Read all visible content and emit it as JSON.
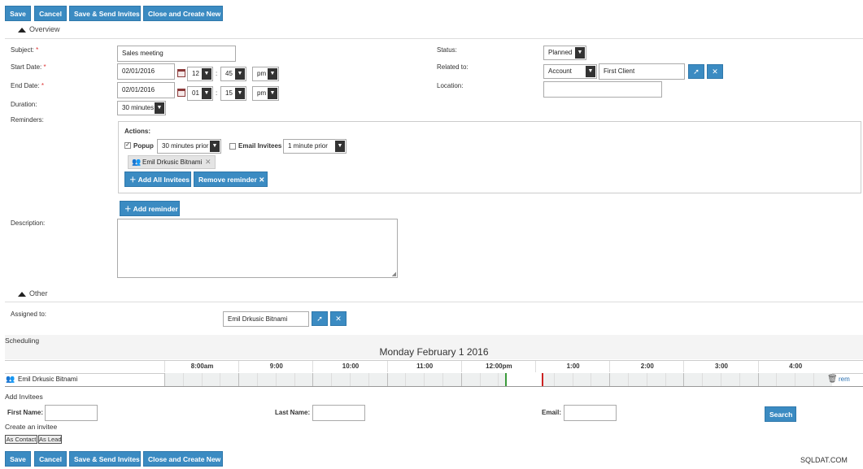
{
  "toolbar": {
    "save": "Save",
    "cancel": "Cancel",
    "save_send": "Save & Send Invites",
    "close_new": "Close and Create New"
  },
  "overview": {
    "heading": "Overview",
    "subject_label": "Subject:",
    "subject_value": "Sales meeting",
    "start_label": "Start Date:",
    "start_date": "02/01/2016",
    "start_hour": "12",
    "start_min": "45",
    "start_ampm": "pm",
    "end_label": "End Date:",
    "end_date": "02/01/2016",
    "end_hour": "01",
    "end_min": "15",
    "end_ampm": "pm",
    "duration_label": "Duration:",
    "duration_value": "30 minutes",
    "reminders_label": "Reminders:",
    "status_label": "Status:",
    "status_value": "Planned",
    "related_label": "Related to:",
    "related_type": "Account",
    "related_value": "First Client",
    "location_label": "Location:",
    "location_value": "",
    "description_label": "Description:",
    "time_sep": ":"
  },
  "reminder": {
    "actions_label": "Actions:",
    "popup_label": "Popup",
    "popup_checked": true,
    "popup_value": "30 minutes prior",
    "email_label": "Email Invitees",
    "email_checked": false,
    "email_value": "1 minute prior",
    "invitee_chip": "Emil Drkusic Bitnami",
    "add_all": "Add All Invitees",
    "remove": "Remove reminder",
    "add_reminder": "Add reminder"
  },
  "other": {
    "heading": "Other",
    "assigned_label": "Assigned to:",
    "assigned_value": "Emil Drkusic Bitnami"
  },
  "scheduling": {
    "heading": "Scheduling",
    "date_title": "Monday February 1 2016",
    "hours": [
      "8:00am",
      "9:00",
      "10:00",
      "11:00",
      "12:00pm",
      "1:00",
      "2:00",
      "3:00",
      "4:00"
    ],
    "invitee_name": "Emil Drkusic Bitnami",
    "remove_label": "rem"
  },
  "invitees": {
    "heading": "Add Invitees",
    "first_name_label": "First Name:",
    "last_name_label": "Last Name:",
    "email_label": "Email:",
    "search": "Search",
    "create_label": "Create an invitee",
    "as_contact": "As Contact",
    "as_lead": "As Lead"
  },
  "watermark": "SQLDAT.COM",
  "colors": {
    "button": "#3b8bc2",
    "meeting_start": "#3a9a3a",
    "meeting_end": "#cc2222"
  }
}
